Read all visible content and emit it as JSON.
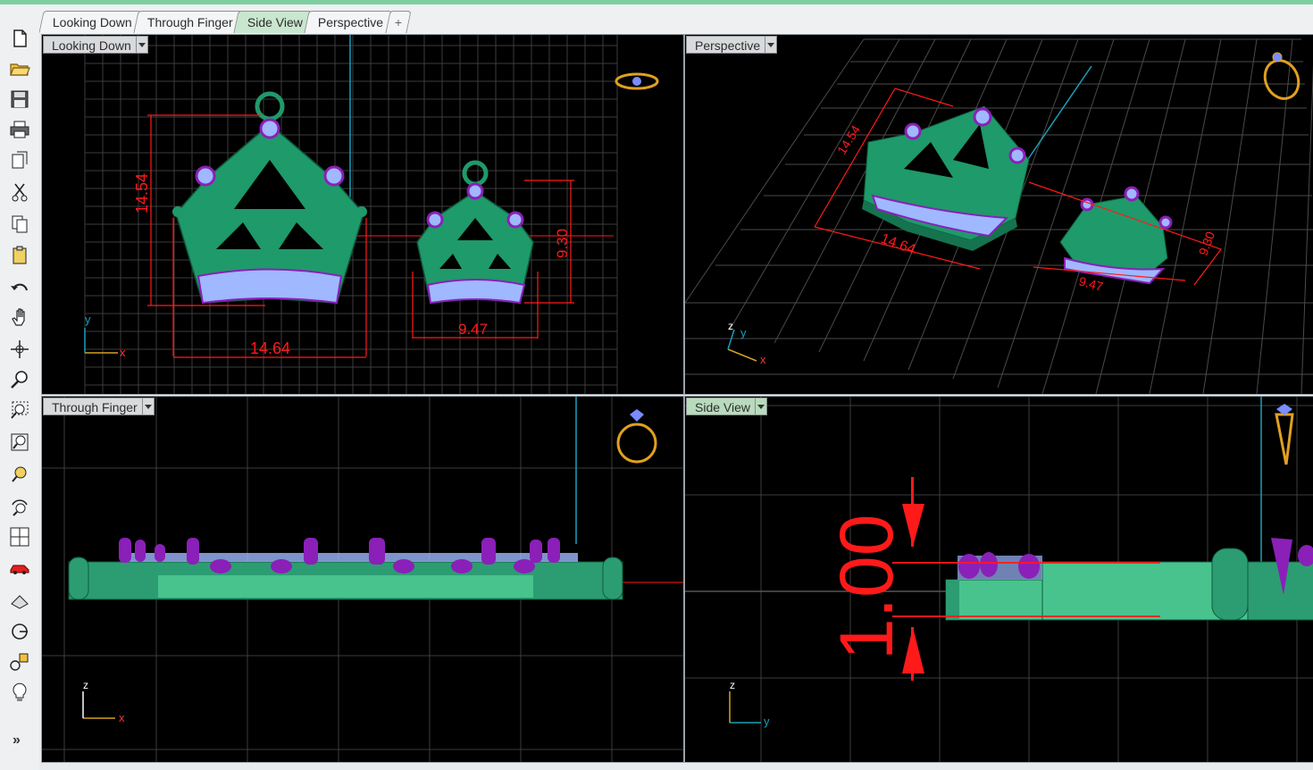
{
  "tabs": [
    {
      "label": "Looking Down",
      "active": false
    },
    {
      "label": "Through Finger",
      "active": false
    },
    {
      "label": "Side View",
      "active": true
    },
    {
      "label": "Perspective",
      "active": false
    }
  ],
  "add_tab_icon": "plus-icon",
  "viewports": {
    "top_left": {
      "title": "Looking Down",
      "dims": {
        "height": "14.54",
        "width": "14.64",
        "small_height": "9.30",
        "small_width": "9.47"
      },
      "axes": {
        "v": "y",
        "h": "x"
      }
    },
    "top_right": {
      "title": "Perspective",
      "dims": {
        "height": "14.54",
        "width": "14.64",
        "small_height": "9.30",
        "small_width": "9.47"
      },
      "axes": {
        "v": "z",
        "d": "y",
        "h": "x"
      }
    },
    "bottom_left": {
      "title": "Through Finger",
      "axes": {
        "v": "z",
        "h": "x"
      }
    },
    "bottom_right": {
      "title": "Side View",
      "dims": {
        "thickness": "1.00"
      },
      "axes": {
        "v": "z",
        "h": "y"
      }
    }
  },
  "toolbar": [
    "new-file-icon",
    "open-folder-icon",
    "save-icon",
    "print-icon",
    "copy-document-icon",
    "cut-icon",
    "copy-icon",
    "paste-icon",
    "undo-icon",
    "pan-hand-icon",
    "rotate-view-icon",
    "zoom-icon",
    "zoom-window-icon",
    "zoom-extents-icon",
    "zoom-selected-icon",
    "rotate-zoom-icon",
    "four-viewports-icon",
    "car-icon",
    "camera-plane-icon",
    "circle-target-icon",
    "shapes-icon",
    "light-bulb-icon"
  ],
  "toolbar_more": "»",
  "colors": {
    "crown": "#1f9a6a",
    "gem": "#9fb8ff",
    "prong": "#8a20b8",
    "grid": "#3a3a3a",
    "dimension": "#ff1a1a",
    "axis": "#1aa0b8",
    "accent": "#c9e6cf"
  }
}
